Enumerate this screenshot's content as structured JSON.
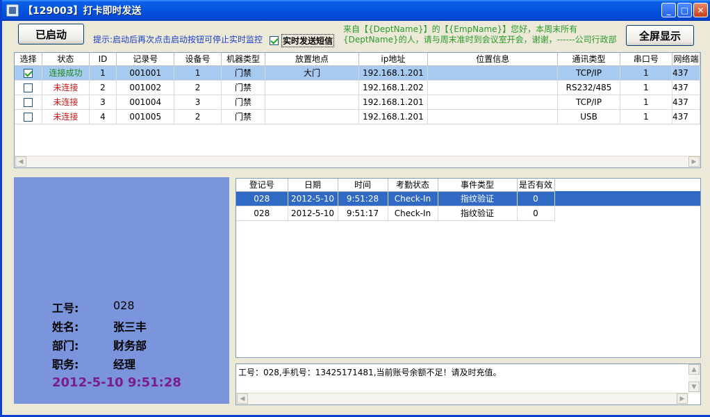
{
  "window": {
    "title": "【129003】打卡即时发送"
  },
  "toolbar": {
    "started_label": "已启动",
    "hint": "提示:启动后再次点击启动按钮可停止实时监控",
    "sms_label": "实时发送短信",
    "notice": "来自【{DeptName}】的【{EmpName}】您好，本周末所有{DeptName}的人，请与周末准时到会议室开会，谢谢，------公司行政部",
    "fullscreen_label": "全屏显示"
  },
  "devices": {
    "columns": [
      "选择",
      "状态",
      "ID",
      "记录号",
      "设备号",
      "机器类型",
      "放置地点",
      "ip地址",
      "位置信息",
      "通讯类型",
      "串口号",
      "网络端"
    ],
    "rows": [
      {
        "checked": true,
        "status": "连接成功",
        "status_kind": "ok",
        "id": "1",
        "record": "001001",
        "device": "1",
        "type": "门禁",
        "place": "大门",
        "ip": "192.168.1.201",
        "location": "",
        "comm": "TCP/IP",
        "port": "1",
        "net": "437"
      },
      {
        "checked": false,
        "status": "未连接",
        "status_kind": "bad",
        "id": "2",
        "record": "001002",
        "device": "2",
        "type": "门禁",
        "place": "",
        "ip": "192.168.1.202",
        "location": "",
        "comm": "RS232/485",
        "port": "1",
        "net": "437"
      },
      {
        "checked": false,
        "status": "未连接",
        "status_kind": "bad",
        "id": "3",
        "record": "001004",
        "device": "3",
        "type": "门禁",
        "place": "",
        "ip": "192.168.1.201",
        "location": "",
        "comm": "TCP/IP",
        "port": "1",
        "net": "437"
      },
      {
        "checked": false,
        "status": "未连接",
        "status_kind": "bad",
        "id": "4",
        "record": "001005",
        "device": "2",
        "type": "门禁",
        "place": "",
        "ip": "192.168.1.201",
        "location": "",
        "comm": "USB",
        "port": "1",
        "net": "437"
      }
    ]
  },
  "employee": {
    "id_label": "工号:",
    "id_value": "028",
    "name_label": "姓名:",
    "name_value": "张三丰",
    "dept_label": "部门:",
    "dept_value": "财务部",
    "title_label": "职务:",
    "title_value": "经理",
    "datetime": "2012-5-10 9:51:28"
  },
  "records": {
    "columns": [
      "登记号",
      "日期",
      "时间",
      "考勤状态",
      "事件类型",
      "是否有效"
    ],
    "rows": [
      {
        "reg": "028",
        "date": "2012-5-10",
        "time": "9:51:28",
        "state": "Check-In",
        "event": "指纹验证",
        "valid": "0"
      },
      {
        "reg": "028",
        "date": "2012-5-10",
        "time": "9:51:17",
        "state": "Check-In",
        "event": "指纹验证",
        "valid": "0"
      }
    ]
  },
  "message": {
    "text": "工号：028,手机号：13425171481,当前账号余额不足！请及时充值。"
  }
}
